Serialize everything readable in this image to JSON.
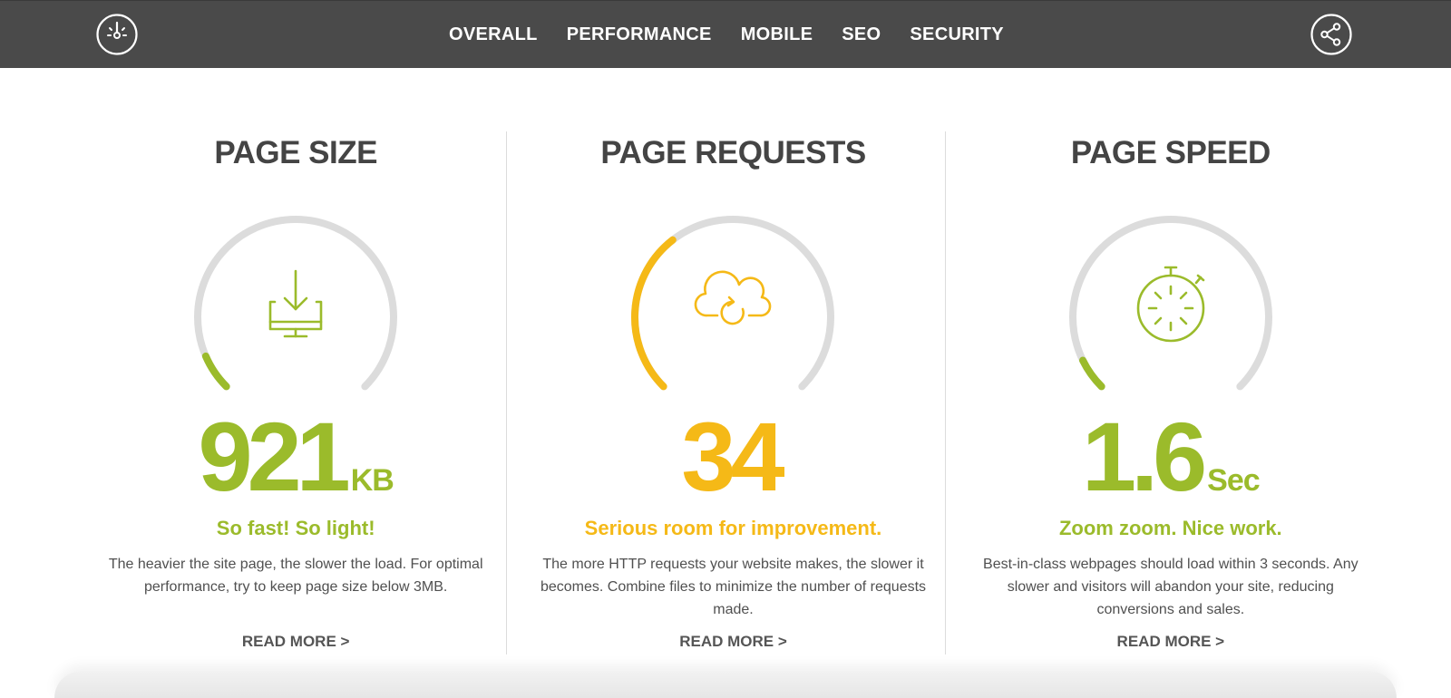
{
  "nav": {
    "items": [
      "OVERALL",
      "PERFORMANCE",
      "MOBILE",
      "SEO",
      "SECURITY"
    ]
  },
  "colors": {
    "good": "#9bbb2b",
    "warn": "#f5b917",
    "track": "#dcdcdc",
    "nav_bg": "#4a4a4a"
  },
  "metrics": [
    {
      "title": "PAGE SIZE",
      "value": "921",
      "unit": "KB",
      "tagline": "So fast! So light!",
      "description": "The heavier the site page, the slower the load. For optimal performance, try to keep page size below 3MB.",
      "read_more": "READ MORE >",
      "gauge_fraction": 0.08,
      "status": "good",
      "icon": "download-monitor-icon"
    },
    {
      "title": "PAGE REQUESTS",
      "value": "34",
      "unit": "",
      "tagline": "Serious room for improvement.",
      "description": "The more HTTP requests your website makes, the slower it becomes. Combine files to minimize the number of requests made.",
      "read_more": "READ MORE >",
      "gauge_fraction": 0.36,
      "status": "warn",
      "icon": "cloud-sync-icon"
    },
    {
      "title": "PAGE SPEED",
      "value": "1.6",
      "unit": "Sec",
      "tagline": "Zoom zoom. Nice work.",
      "description": "Best-in-class webpages should load within 3 seconds. Any slower and visitors will abandon your site, reducing conversions and sales.",
      "read_more": "READ MORE >",
      "gauge_fraction": 0.07,
      "status": "good",
      "icon": "stopwatch-icon"
    }
  ]
}
